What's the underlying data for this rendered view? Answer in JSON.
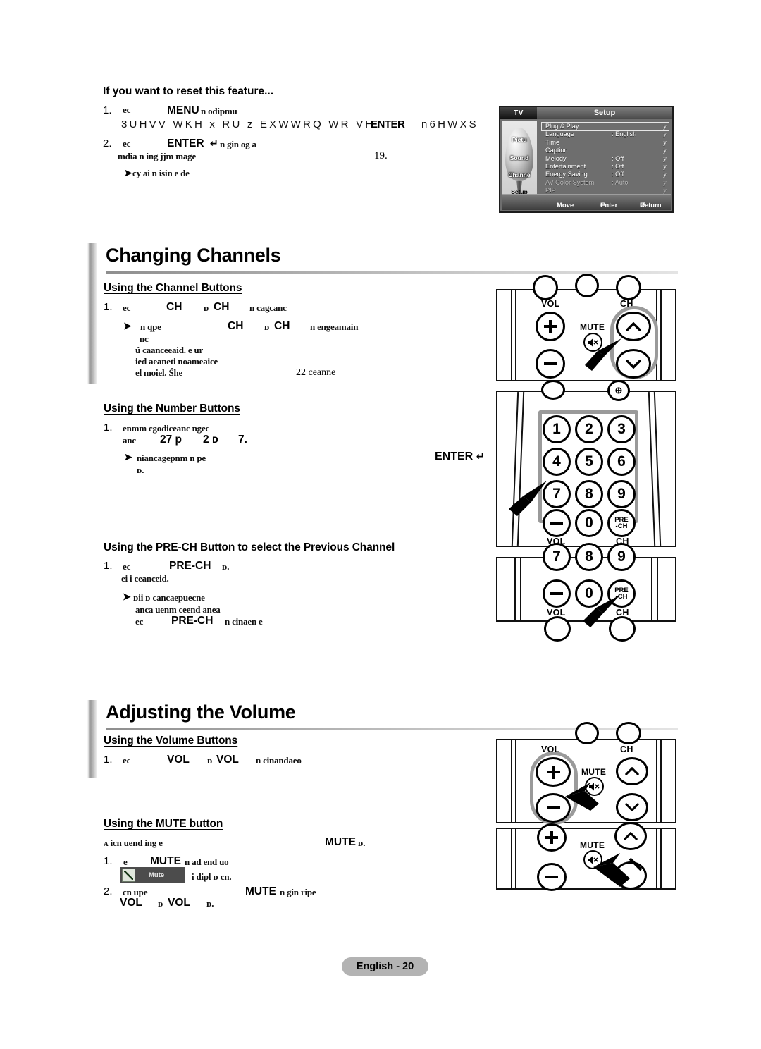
{
  "document": {
    "footer_label": "English - 20"
  },
  "reset_section": {
    "heading": "If you want to reset this feature...",
    "step1": {
      "number": "1.",
      "pre": "ec",
      "button": "MENU",
      "post": "n  odipmu",
      "cipher_line": "3UHVV WKH x RU z EXWWRQ WR VH",
      "cipher_overlap": "ENTER",
      "cipher_tail": "n6HWXS"
    },
    "step2": {
      "number": "2.",
      "pre": "ec",
      "button": "ENTER",
      "post": "n gin  og  a",
      "line2": "mdia n ing  jjm  mage",
      "page_ref": "19."
    },
    "note": "cy  ai n isin e de"
  },
  "osd": {
    "tv_label": "TV",
    "title": "Setup",
    "side_items": [
      "Pictu",
      "Sound",
      "Channe",
      "Setup"
    ],
    "rows": [
      {
        "label": "Plug & Play",
        "value": "",
        "chev": "y",
        "selected": true
      },
      {
        "label": "Language",
        "value": ": English",
        "chev": "y",
        "selected": false
      },
      {
        "label": "Time",
        "value": "",
        "chev": "y",
        "selected": false
      },
      {
        "label": "Caption",
        "value": "",
        "chev": "y",
        "selected": false
      },
      {
        "label": "Melody",
        "value": ": Off",
        "chev": "y",
        "selected": false
      },
      {
        "label": "Entertainment",
        "value": ": Off",
        "chev": "y",
        "selected": false
      },
      {
        "label": "Energy Saving",
        "value": ": Off",
        "chev": "y",
        "selected": false
      },
      {
        "label": "AV Color System",
        "value": ": Auto",
        "chev": "y",
        "selected": false,
        "dim": true
      },
      {
        "label": "PIP",
        "value": "",
        "chev": "y",
        "selected": false,
        "dim": true
      }
    ],
    "bottom": [
      {
        "icon": "↕",
        "label": "Move"
      },
      {
        "icon": "↵",
        "label": "Enter"
      },
      {
        "icon": "↺",
        "label": "Return"
      }
    ]
  },
  "changing_channels": {
    "title": "Changing Channels",
    "sub1": {
      "heading": "Using the Channel Buttons",
      "step_no": "1.",
      "pre": "ec",
      "btn_a": "CH",
      "mid": "ᴅ",
      "btn_b": "CH",
      "post": "n cagcanc",
      "note_lines": [
        {
          "pre": "n  qpe",
          "btn_a": "CH",
          "mid": "ᴅ",
          "btn_b": "CH",
          "post": "n  engeamain"
        },
        {
          "text": "nc"
        },
        {
          "text": "ú  caanceeaid.  e ur"
        },
        {
          "text": "ied  aeaneti  noameaice"
        },
        {
          "text": "el  moiel.  Śhe",
          "right": "22  ceanne"
        }
      ]
    },
    "sub2": {
      "heading": "Using the Number Buttons",
      "step_no": "1.",
      "l1": "enmm  cgodiceanc  ngec",
      "l2_a": "anc",
      "l2_b": "27 p",
      "l2_c": "2 ᴅ",
      "l2_d": "7.",
      "note": "niancagepnm  n  pe",
      "note2": "ᴅ.",
      "enter_label": "ENTER"
    },
    "sub3": {
      "heading": "Using the PRE-CH Button to select the Previous Channel",
      "step_no": "1.",
      "pre": "ec",
      "btn": "PRE-CH",
      "post": "ᴅ.",
      "l2": "ei i  ceanceid.",
      "note_lines": [
        {
          "text": "ᴅii ᴅ cancaepuecne"
        },
        {
          "text": "anca uenm  ceend  anea"
        },
        {
          "pre": "ec",
          "btn": "PRE-CH",
          "post": "n  cinaen  e"
        }
      ]
    }
  },
  "adjusting_volume": {
    "title": "Adjusting the Volume",
    "sub1": {
      "heading": "Using the Volume Buttons",
      "step_no": "1.",
      "pre": "ec",
      "btn_a": "VOL",
      "mid": "ᴅ",
      "btn_b": "VOL",
      "post": "n  cinandaeo"
    },
    "sub2": {
      "heading": "Using the MUTE button",
      "intro_left": "ᴀ icn  uend ing  e",
      "intro_btn": "MUTE",
      "intro_post": "ᴅ.",
      "step1_no": "1.",
      "step1_pre": "e",
      "step1_btn": "MUTE",
      "step1_post": "n  ad  end  uo",
      "chip_label": "Mute",
      "chip_after": "i  dipl ᴅ cn.",
      "step2_no": "2.",
      "step2_pre": "cn  upe",
      "step2_btn": "MUTE",
      "step2_post": "n  gin  ripe",
      "step2_l2_a": "VOL",
      "step2_l2_mid": "ᴅ",
      "step2_l2_b": "VOL",
      "step2_l2_end": "ᴅ."
    }
  },
  "remotes": {
    "vol_ch_mute": {
      "vol_label": "VOL",
      "ch_label": "CH",
      "mute_label": "MUTE",
      "plus": "+",
      "minus": "−",
      "up": "∧",
      "down": "∨",
      "highlight": "ch-group"
    },
    "number_pad": {
      "keys": [
        "1",
        "2",
        "3",
        "4",
        "5",
        "6",
        "7",
        "8",
        "9"
      ],
      "zero": "0",
      "prech": "PRE\n-CH",
      "minus": "−",
      "vol_label": "VOL",
      "ch_label": "CH",
      "highlight": "number-group"
    },
    "prech_remote": {
      "keys": [
        "7",
        "8",
        "9"
      ],
      "zero": "0",
      "minus": "−",
      "prech_top": "PRE",
      "prech_bottom": "-CH",
      "vol_label": "VOL",
      "ch_label": "CH"
    },
    "volume_remote": {
      "vol_label": "VOL",
      "ch_label": "CH",
      "mute_label": "MUTE",
      "plus": "+",
      "minus": "−",
      "up": "∧",
      "down": "∨",
      "highlight": "vol-group"
    },
    "mute_remote": {
      "mute_label": "MUTE",
      "plus": "+",
      "minus": "−",
      "up": "∧"
    }
  },
  "colors": {
    "highlight_gray": "#9a9a9a",
    "osd_background": "#6e6e6e",
    "footer_gray": "#b3b3b3"
  }
}
